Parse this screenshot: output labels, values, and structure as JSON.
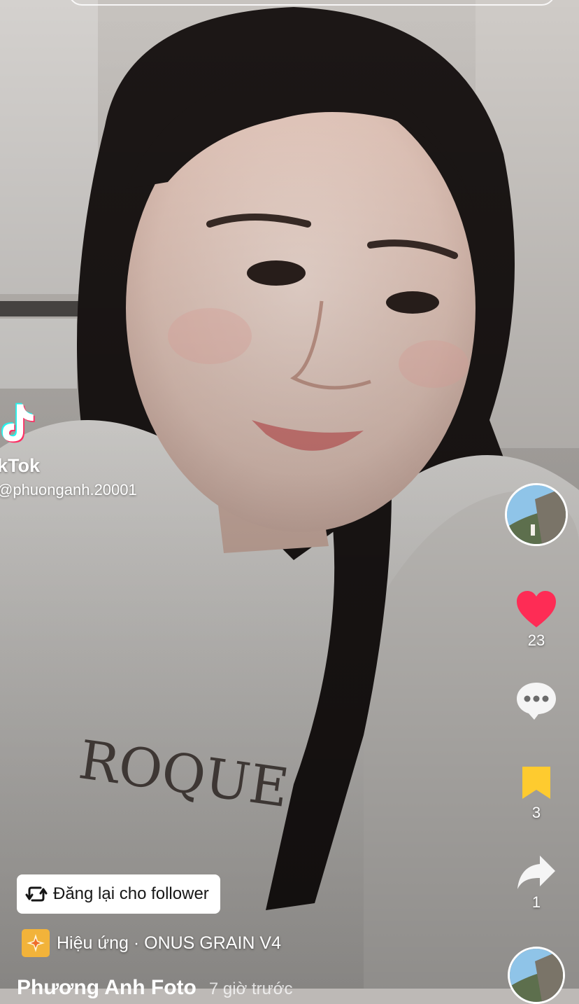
{
  "video": {
    "watermark_brand": "kTok",
    "watermark_handle": "@phuonganh.20001"
  },
  "rail": {
    "like_count": "23",
    "comment_count": "",
    "save_count": "3",
    "share_count": "1"
  },
  "repost_button": {
    "label": "Đăng lại cho follower"
  },
  "effect": {
    "label": "Hiệu ứng · ONUS GRAIN V4"
  },
  "author": {
    "name": "Phương Anh Foto",
    "time": "7 giờ trước"
  },
  "colors": {
    "like": "#fe2c55",
    "save": "#fecb2f",
    "effect_badge": "#f2b33a"
  }
}
